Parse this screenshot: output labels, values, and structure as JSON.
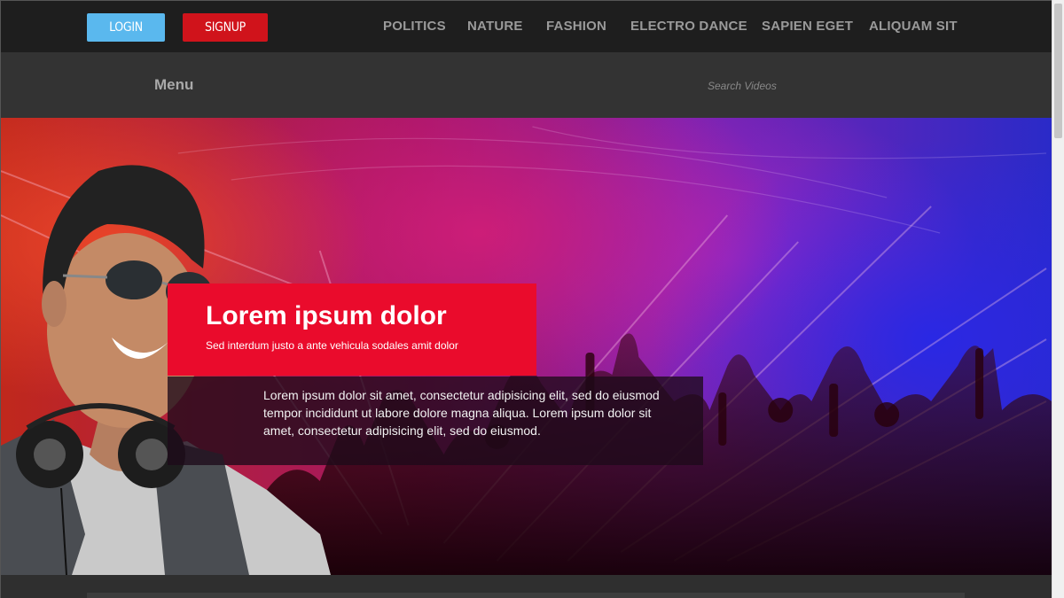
{
  "header": {
    "login_label": "LOGIN",
    "signup_label": "SIGNUP",
    "nav": [
      "POLITICS",
      "NATURE",
      "FASHION",
      "ELECTRO DANCE",
      "SAPIEN EGET",
      "ALIQUAM SIT"
    ]
  },
  "menubar": {
    "menu_label": "Menu",
    "search_placeholder": "Search Videos"
  },
  "hero": {
    "title": "Lorem ipsum dolor",
    "subtitle": "Sed interdum justo a ante vehicula sodales amit dolor",
    "description": "Lorem ipsum dolor sit amet, consectetur adipisicing elit, sed do eiusmod tempor incididunt ut labore dolore magna aliqua. Lorem ipsum dolor sit amet, consectetur adipisicing elit, sed do eiusmod."
  },
  "colors": {
    "login": "#5ab8ee",
    "signup": "#d0131b",
    "accent": "#ea0b2c",
    "topbar": "#1e1e1e",
    "menubar": "#333333"
  }
}
